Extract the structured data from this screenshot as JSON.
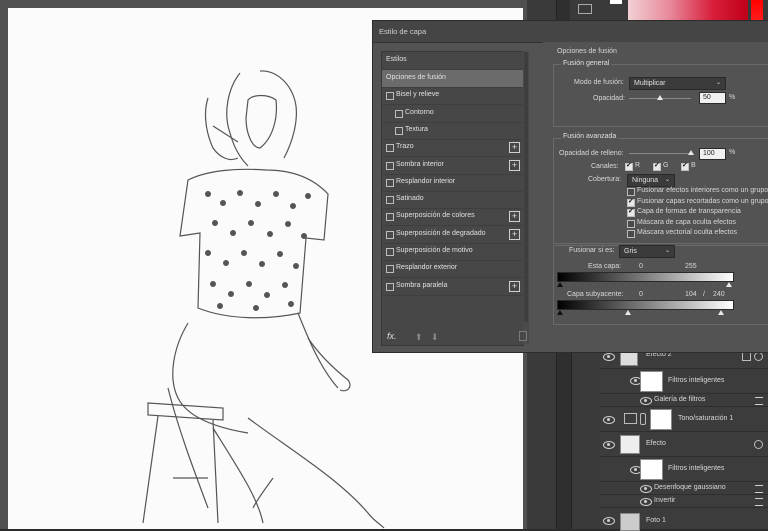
{
  "dialog": {
    "title": "Estilo de capa",
    "list_header": "Estilos",
    "styles": [
      {
        "label": "Opciones de fusión",
        "checkbox": false,
        "plus": false,
        "selected": true,
        "indent": 0
      },
      {
        "label": "Bisel y relieve",
        "checkbox": true,
        "plus": false,
        "selected": false,
        "indent": 0
      },
      {
        "label": "Contorno",
        "checkbox": true,
        "plus": false,
        "selected": false,
        "indent": 1
      },
      {
        "label": "Textura",
        "checkbox": true,
        "plus": false,
        "selected": false,
        "indent": 1
      },
      {
        "label": "Trazo",
        "checkbox": true,
        "plus": true,
        "selected": false,
        "indent": 0
      },
      {
        "label": "Sombra interior",
        "checkbox": true,
        "plus": true,
        "selected": false,
        "indent": 0
      },
      {
        "label": "Resplandor interior",
        "checkbox": true,
        "plus": false,
        "selected": false,
        "indent": 0
      },
      {
        "label": "Satinado",
        "checkbox": true,
        "plus": false,
        "selected": false,
        "indent": 0
      },
      {
        "label": "Superposición de colores",
        "checkbox": true,
        "plus": true,
        "selected": false,
        "indent": 0
      },
      {
        "label": "Superposición de degradado",
        "checkbox": true,
        "plus": true,
        "selected": false,
        "indent": 0
      },
      {
        "label": "Superposición de motivo",
        "checkbox": true,
        "plus": false,
        "selected": false,
        "indent": 0
      },
      {
        "label": "Resplandor exterior",
        "checkbox": true,
        "plus": false,
        "selected": false,
        "indent": 0
      },
      {
        "label": "Sombra paralela",
        "checkbox": true,
        "plus": true,
        "selected": false,
        "indent": 0
      }
    ],
    "fx_label": "fx.",
    "blend": {
      "heading": "Opciones de fusión",
      "general": {
        "title": "Fusión general",
        "mode_label": "Modo de fusión:",
        "mode_value": "Multiplicar",
        "opacity_label": "Opacidad:",
        "opacity_value": "50",
        "opacity_fraction": 0.5,
        "unit": "%"
      },
      "advanced": {
        "title": "Fusión avanzada",
        "fill_label": "Opacidad de relleno:",
        "fill_value": "100",
        "fill_fraction": 1.0,
        "unit": "%",
        "channels_label": "Canales:",
        "channels": [
          "R",
          "G",
          "B"
        ],
        "knockout_label": "Cobertura:",
        "knockout_value": "Ninguna",
        "options": [
          {
            "label": "Fusionar efectos interiores como un grupo",
            "checked": false
          },
          {
            "label": "Fusionar capas recortadas como un grupo",
            "checked": true
          },
          {
            "label": "Capa de formas de transparencia",
            "checked": true
          },
          {
            "label": "Máscara de capa oculta efectos",
            "checked": false
          },
          {
            "label": "Máscara vectorial oculta efectos",
            "checked": false
          }
        ]
      },
      "blendif": {
        "label": "Fusionar si es:",
        "value": "Gris",
        "this_layer_label": "Esta capa:",
        "this_layer_min": "0",
        "this_layer_max": "255",
        "underlying_label": "Capa subyacente:",
        "underlying_min": "0",
        "underlying_split": "104",
        "underlying_sep": "/",
        "underlying_max": "240"
      }
    }
  },
  "layers": [
    {
      "name": "Efecto 2",
      "type": "smart"
    },
    {
      "name": "Filtros inteligentes",
      "type": "filtermask"
    },
    {
      "name": "Galería de filtros",
      "type": "filter"
    },
    {
      "name": "Tono/saturación 1",
      "type": "adjustment"
    },
    {
      "name": "Efecto",
      "type": "smart"
    },
    {
      "name": "Filtros inteligentes",
      "type": "filtermask"
    },
    {
      "name": "Desenfoque gaussiano",
      "type": "filter"
    },
    {
      "name": "Invertir",
      "type": "filter"
    },
    {
      "name": "Foto 1",
      "type": "photo"
    }
  ],
  "colors": {
    "panel": "#535353",
    "list": "#474747",
    "selected": "#6b6b6b",
    "canvas": "#fbfbfb"
  }
}
